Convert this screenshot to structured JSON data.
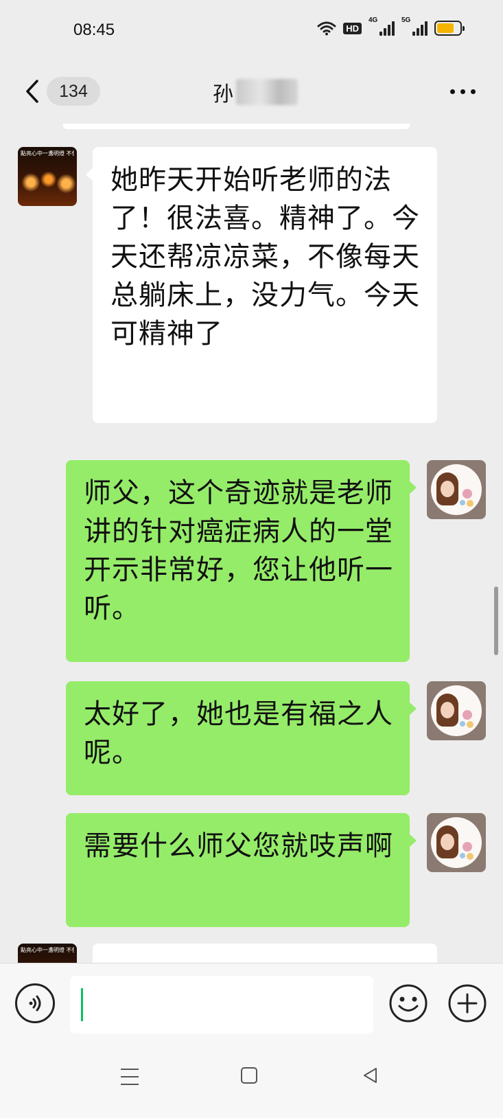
{
  "status_bar": {
    "time": "08:45",
    "hd_badge": "HD",
    "network_1": "4G",
    "network_2": "5G",
    "battery_level": 0.75,
    "battery_color": "#f4b400"
  },
  "header": {
    "unread_count": "134",
    "title": "孙",
    "back_icon": "chevron-left-icon",
    "more_icon": "more-dots-icon"
  },
  "colors": {
    "outgoing_bubble": "#95ec69",
    "incoming_bubble": "#ffffff",
    "background": "#ededed",
    "caret": "#07c160"
  },
  "messages": [
    {
      "direction": "incoming",
      "avatar_caption": "點亮心中一盞明燈 不但照亮自己 也照亮人間",
      "text": "她昨天开始听老师的法了！很法喜。精神了。今天还帮凉凉菜，不像每天总躺床上，没力气。今天可精神了"
    },
    {
      "direction": "outgoing",
      "text": "师父，这个奇迹就是老师讲的针对癌症病人的一堂开示非常好，您让他听一听。"
    },
    {
      "direction": "outgoing",
      "text": "太好了，她也是有福之人呢。"
    },
    {
      "direction": "outgoing",
      "text": "需要什么师父您就吱声啊"
    },
    {
      "direction": "incoming",
      "avatar_caption": "點亮心中一盞明燈 不但照亮自己 也照亮人間",
      "text": ""
    }
  ],
  "input_bar": {
    "message_value": "",
    "voice_icon": "voice-icon",
    "emoji_icon": "emoji-icon",
    "plus_icon": "plus-icon"
  },
  "nav_bar": {
    "menu_icon": "menu-icon",
    "home_icon": "home-icon",
    "back_icon": "back-triangle-icon"
  }
}
